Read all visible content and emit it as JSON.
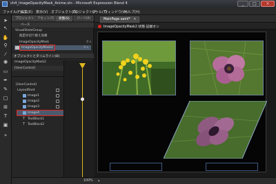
{
  "titlebar": {
    "title": "ch4_ImageOpacityMask_Anime.sln - Microsoft Expression Blend 4",
    "minimize": "_",
    "maximize": "□",
    "close": "×"
  },
  "menu": [
    "ファイル(F)",
    "編集(E)",
    "表示(V)",
    "オブジェクト(O)",
    "プロジェクト(P)",
    "ツール(T)",
    "ウィンドウ(W)",
    "ヘルプ(H)"
  ],
  "left_tabs": {
    "projects": "プロジェクト(J)",
    "assets": "アセット(T)",
    "triggers": "状態(S)",
    "parts": "パーツ(P)"
  },
  "states": {
    "header": "ベース",
    "group": "VisualStateGroup",
    "default_transition": "既定の切り替え効果",
    "state1": "ImageOpacityMask",
    "state2": "ImageOpacityMask2",
    "state1_time": "0 s",
    "state2_time": "0 s"
  },
  "objects": {
    "header": "オブジェクトとタイムライン(B)",
    "storyboard": "ImageOpacityMask2",
    "usercontrol_top": "[UserControl]",
    "usercontrol": "[UserControl]",
    "layoutroot": "LayoutRoot",
    "items": [
      "Image1",
      "Image2",
      "Image3",
      "Image4",
      "TextBlock1",
      "TextBlock2"
    ],
    "time": "0:00.000"
  },
  "document": {
    "tab": "MainPage.xaml*",
    "close": "×",
    "state_label": "ImageOpacityMask2 状態 記録オン",
    "zoom": "100%"
  },
  "colors": {
    "record_red": "#e0261e",
    "playhead": "#e0b820",
    "selection": "#4c5a6e",
    "frame_blue": "#3d5a86"
  }
}
